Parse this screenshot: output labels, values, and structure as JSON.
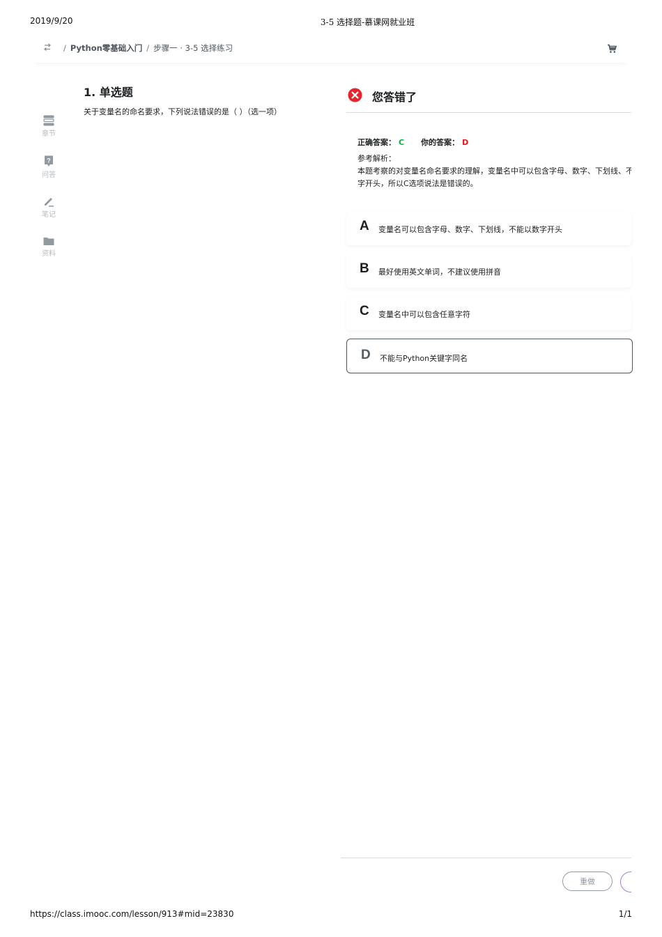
{
  "print": {
    "date": "2019/9/20",
    "page_title": "3-5 选择题-慕课网就业班",
    "url": "https://class.imooc.com/lesson/913#mid=23830",
    "page_num": "1/1"
  },
  "breadcrumb": {
    "sep1": "/",
    "course": "Python零基础入门",
    "sep2": "/",
    "step": "步骤一 · 3-5 选择练习"
  },
  "sidenav": {
    "items": [
      {
        "label": "章节",
        "icon": "chapter-icon"
      },
      {
        "label": "问答",
        "icon": "question-icon"
      },
      {
        "label": "笔记",
        "icon": "pencil-icon"
      },
      {
        "label": "资料",
        "icon": "folder-icon"
      }
    ]
  },
  "question": {
    "title": "1. 单选题",
    "text": "关于变量名的命名要求，下列说法错误的是（ ）（选一项）"
  },
  "result": {
    "title": "您答错了",
    "correct_label": "正确答案：",
    "correct_value": "C",
    "your_label": "你的答案：",
    "your_value": "D",
    "analysis_label": "参考解析：",
    "analysis_line1": "本题考察的对变量名命名要求的理解，变量名中可以包含字母、数字、下划线、不",
    "analysis_line2": "字开头，所以C选项说法是错误的。"
  },
  "options": [
    {
      "letter": "A",
      "text": "变量名可以包含字母、数字、下划线，不能以数字开头"
    },
    {
      "letter": "B",
      "text": "最好使用英文单词，不建议使用拼音"
    },
    {
      "letter": "C",
      "text": "变量名中可以包含任意字符"
    },
    {
      "letter": "D",
      "text": "不能与Python关键字同名",
      "selected": true
    }
  ],
  "buttons": {
    "redo": "重做"
  },
  "colors": {
    "correct": "#00b43c",
    "wrong": "#f20d0d",
    "text": "#1c1f21",
    "muted": "#9199a1"
  }
}
